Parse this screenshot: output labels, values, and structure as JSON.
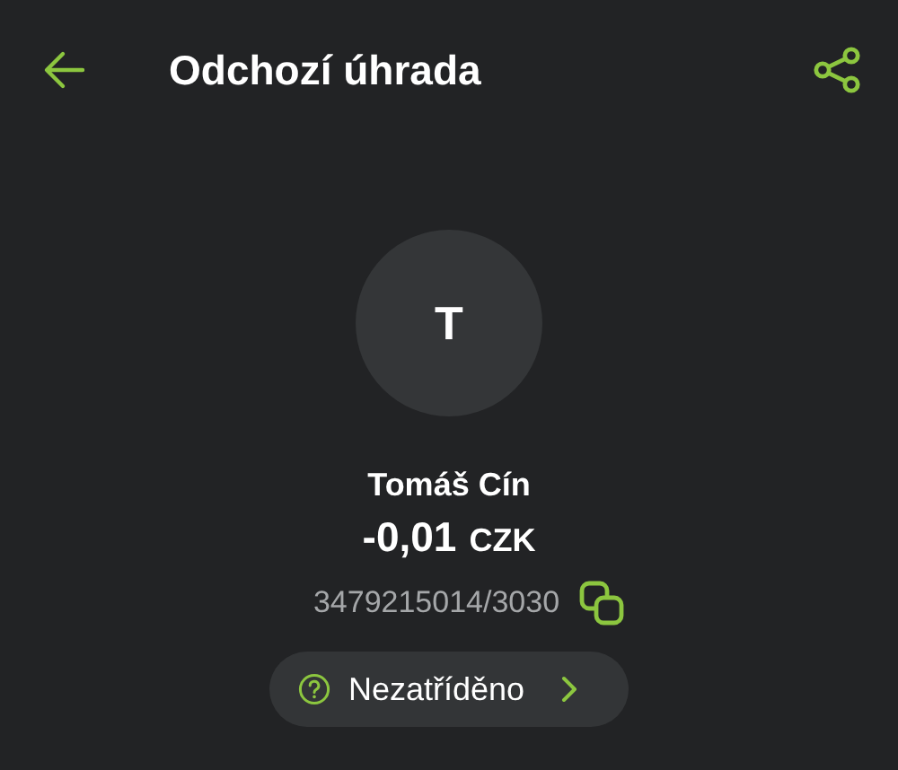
{
  "header": {
    "title": "Odchozí úhrada"
  },
  "avatar": {
    "initial": "T"
  },
  "payee": {
    "name": "Tomáš Cín",
    "amount": "-0,01",
    "currency": "CZK",
    "account": "3479215014/3030"
  },
  "category": {
    "label": "Nezatříděno"
  }
}
